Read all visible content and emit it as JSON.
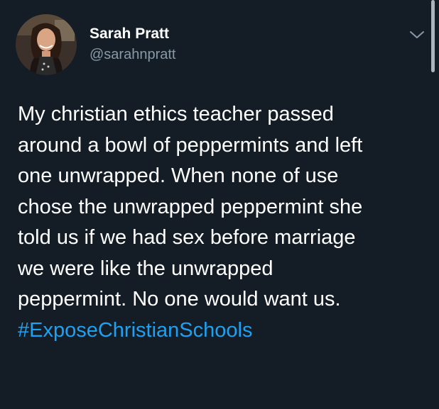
{
  "tweet": {
    "author": {
      "display_name": "Sarah Pratt",
      "handle": "@sarahnpratt",
      "avatar_icon": "profile-photo"
    },
    "menu_icon": "chevron-down-icon",
    "body_lines": [
      "My christian ethics teacher passed",
      "around a bowl of peppermints and left",
      "one unwrapped.  When none of use",
      "chose the unwrapped peppermint she",
      "told us if we had sex before marriage",
      "we were like the unwrapped",
      "peppermint.  No one would want us."
    ],
    "hashtag": "#ExposeChristianSchools"
  },
  "colors": {
    "background": "#141d26",
    "text": "#ffffff",
    "handle": "#8899a6",
    "link": "#1da1f2"
  }
}
